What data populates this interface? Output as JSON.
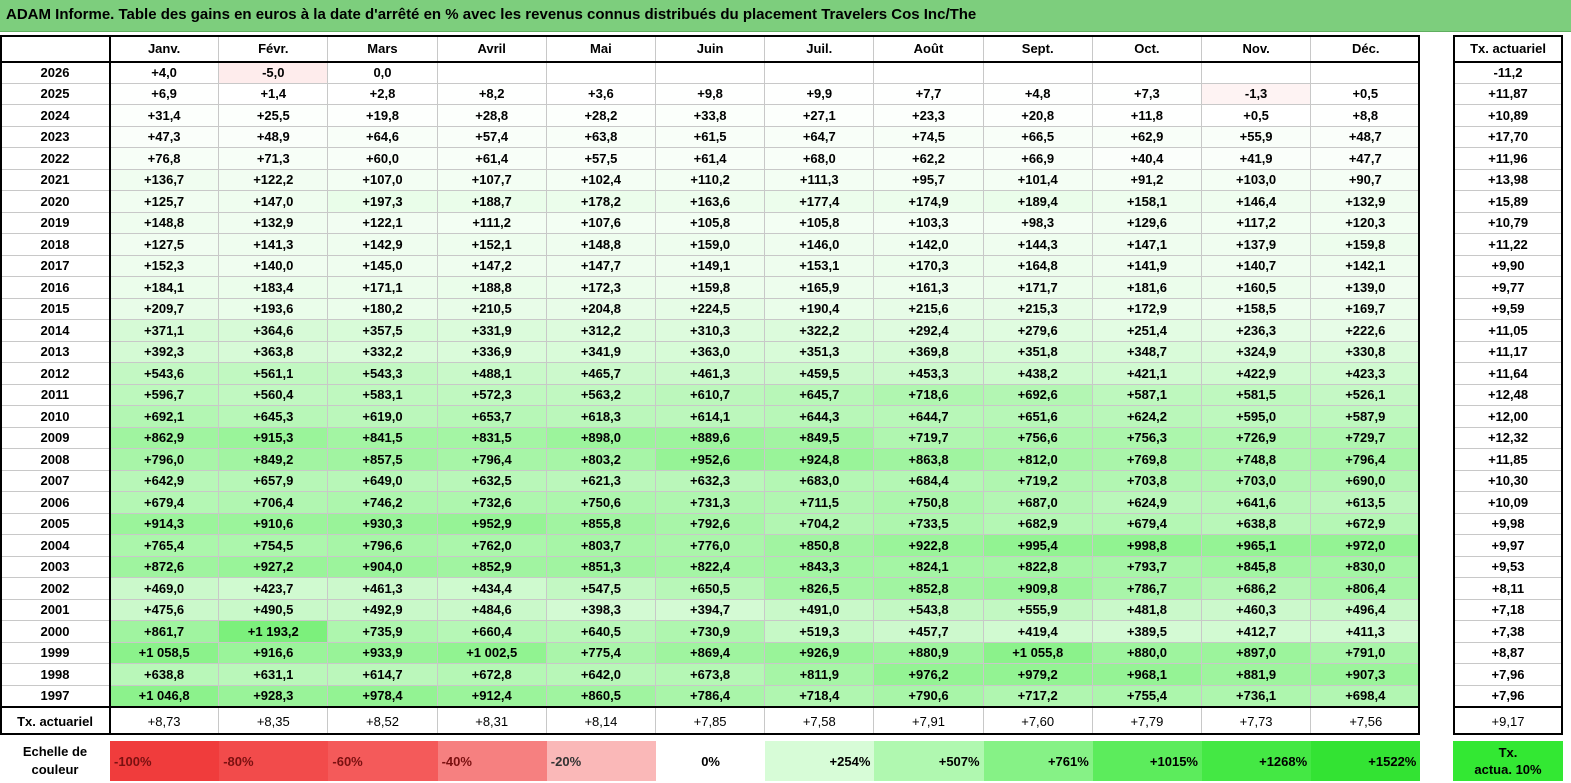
{
  "title": "ADAM Informe. Table des gains en euros à la date d'arrêté en % avec les revenus connus distribués du placement Travelers Cos Inc/The",
  "chart_data": {
    "type": "table",
    "columns": [
      "Janv.",
      "Févr.",
      "Mars",
      "Avril",
      "Mai",
      "Juin",
      "Juil.",
      "Août",
      "Sept.",
      "Oct.",
      "Nov.",
      "Déc."
    ],
    "annual_header": "Tx. actuariel",
    "rows": [
      {
        "year": "2026",
        "values": [
          "+4,0",
          "-5,0",
          "0,0",
          "",
          "",
          "",
          "",
          "",
          "",
          "",
          "",
          ""
        ],
        "annual": "-11,2"
      },
      {
        "year": "2025",
        "values": [
          "+6,9",
          "+1,4",
          "+2,8",
          "+8,2",
          "+3,6",
          "+9,8",
          "+9,9",
          "+7,7",
          "+4,8",
          "+7,3",
          "-1,3",
          "+0,5"
        ],
        "annual": "+11,87"
      },
      {
        "year": "2024",
        "values": [
          "+31,4",
          "+25,5",
          "+19,8",
          "+28,8",
          "+28,2",
          "+33,8",
          "+27,1",
          "+23,3",
          "+20,8",
          "+11,8",
          "+0,5",
          "+8,8"
        ],
        "annual": "+10,89"
      },
      {
        "year": "2023",
        "values": [
          "+47,3",
          "+48,9",
          "+64,6",
          "+57,4",
          "+63,8",
          "+61,5",
          "+64,7",
          "+74,5",
          "+66,5",
          "+62,9",
          "+55,9",
          "+48,7"
        ],
        "annual": "+17,70"
      },
      {
        "year": "2022",
        "values": [
          "+76,8",
          "+71,3",
          "+60,0",
          "+61,4",
          "+57,5",
          "+61,4",
          "+68,0",
          "+62,2",
          "+66,9",
          "+40,4",
          "+41,9",
          "+47,7"
        ],
        "annual": "+11,96"
      },
      {
        "year": "2021",
        "values": [
          "+136,7",
          "+122,2",
          "+107,0",
          "+107,7",
          "+102,4",
          "+110,2",
          "+111,3",
          "+95,7",
          "+101,4",
          "+91,2",
          "+103,0",
          "+90,7"
        ],
        "annual": "+13,98"
      },
      {
        "year": "2020",
        "values": [
          "+125,7",
          "+147,0",
          "+197,3",
          "+188,7",
          "+178,2",
          "+163,6",
          "+177,4",
          "+174,9",
          "+189,4",
          "+158,1",
          "+146,4",
          "+132,9"
        ],
        "annual": "+15,89"
      },
      {
        "year": "2019",
        "values": [
          "+148,8",
          "+132,9",
          "+122,1",
          "+111,2",
          "+107,6",
          "+105,8",
          "+105,8",
          "+103,3",
          "+98,3",
          "+129,6",
          "+117,2",
          "+120,3"
        ],
        "annual": "+10,79"
      },
      {
        "year": "2018",
        "values": [
          "+127,5",
          "+141,3",
          "+142,9",
          "+152,1",
          "+148,8",
          "+159,0",
          "+146,0",
          "+142,0",
          "+144,3",
          "+147,1",
          "+137,9",
          "+159,8"
        ],
        "annual": "+11,22"
      },
      {
        "year": "2017",
        "values": [
          "+152,3",
          "+140,0",
          "+145,0",
          "+147,2",
          "+147,7",
          "+149,1",
          "+153,1",
          "+170,3",
          "+164,8",
          "+141,9",
          "+140,7",
          "+142,1"
        ],
        "annual": "+9,90"
      },
      {
        "year": "2016",
        "values": [
          "+184,1",
          "+183,4",
          "+171,1",
          "+188,8",
          "+172,3",
          "+159,8",
          "+165,9",
          "+161,3",
          "+171,7",
          "+181,6",
          "+160,5",
          "+139,0"
        ],
        "annual": "+9,77"
      },
      {
        "year": "2015",
        "values": [
          "+209,7",
          "+193,6",
          "+180,2",
          "+210,5",
          "+204,8",
          "+224,5",
          "+190,4",
          "+215,6",
          "+215,3",
          "+172,9",
          "+158,5",
          "+169,7"
        ],
        "annual": "+9,59"
      },
      {
        "year": "2014",
        "values": [
          "+371,1",
          "+364,6",
          "+357,5",
          "+331,9",
          "+312,2",
          "+310,3",
          "+322,2",
          "+292,4",
          "+279,6",
          "+251,4",
          "+236,3",
          "+222,6"
        ],
        "annual": "+11,05"
      },
      {
        "year": "2013",
        "values": [
          "+392,3",
          "+363,8",
          "+332,2",
          "+336,9",
          "+341,9",
          "+363,0",
          "+351,3",
          "+369,8",
          "+351,8",
          "+348,7",
          "+324,9",
          "+330,8"
        ],
        "annual": "+11,17"
      },
      {
        "year": "2012",
        "values": [
          "+543,6",
          "+561,1",
          "+543,3",
          "+488,1",
          "+465,7",
          "+461,3",
          "+459,5",
          "+453,3",
          "+438,2",
          "+421,1",
          "+422,9",
          "+423,3"
        ],
        "annual": "+11,64"
      },
      {
        "year": "2011",
        "values": [
          "+596,7",
          "+560,4",
          "+583,1",
          "+572,3",
          "+563,2",
          "+610,7",
          "+645,7",
          "+718,6",
          "+692,6",
          "+587,1",
          "+581,5",
          "+526,1"
        ],
        "annual": "+12,48"
      },
      {
        "year": "2010",
        "values": [
          "+692,1",
          "+645,3",
          "+619,0",
          "+653,7",
          "+618,3",
          "+614,1",
          "+644,3",
          "+644,7",
          "+651,6",
          "+624,2",
          "+595,0",
          "+587,9"
        ],
        "annual": "+12,00"
      },
      {
        "year": "2009",
        "values": [
          "+862,9",
          "+915,3",
          "+841,5",
          "+831,5",
          "+898,0",
          "+889,6",
          "+849,5",
          "+719,7",
          "+756,6",
          "+756,3",
          "+726,9",
          "+729,7"
        ],
        "annual": "+12,32"
      },
      {
        "year": "2008",
        "values": [
          "+796,0",
          "+849,2",
          "+857,5",
          "+796,4",
          "+803,2",
          "+952,6",
          "+924,8",
          "+863,8",
          "+812,0",
          "+769,8",
          "+748,8",
          "+796,4"
        ],
        "annual": "+11,85"
      },
      {
        "year": "2007",
        "values": [
          "+642,9",
          "+657,9",
          "+649,0",
          "+632,5",
          "+621,3",
          "+632,3",
          "+683,0",
          "+684,4",
          "+719,2",
          "+703,8",
          "+703,0",
          "+690,0"
        ],
        "annual": "+10,30"
      },
      {
        "year": "2006",
        "values": [
          "+679,4",
          "+706,4",
          "+746,2",
          "+732,6",
          "+750,6",
          "+731,3",
          "+711,5",
          "+750,8",
          "+687,0",
          "+624,9",
          "+641,6",
          "+613,5"
        ],
        "annual": "+10,09"
      },
      {
        "year": "2005",
        "values": [
          "+914,3",
          "+910,6",
          "+930,3",
          "+952,9",
          "+855,8",
          "+792,6",
          "+704,2",
          "+733,5",
          "+682,9",
          "+679,4",
          "+638,8",
          "+672,9"
        ],
        "annual": "+9,98"
      },
      {
        "year": "2004",
        "values": [
          "+765,4",
          "+754,5",
          "+796,6",
          "+762,0",
          "+803,7",
          "+776,0",
          "+850,8",
          "+922,8",
          "+995,4",
          "+998,8",
          "+965,1",
          "+972,0"
        ],
        "annual": "+9,97"
      },
      {
        "year": "2003",
        "values": [
          "+872,6",
          "+927,2",
          "+904,0",
          "+852,9",
          "+851,3",
          "+822,4",
          "+843,3",
          "+824,1",
          "+822,8",
          "+793,7",
          "+845,8",
          "+830,0"
        ],
        "annual": "+9,53"
      },
      {
        "year": "2002",
        "values": [
          "+469,0",
          "+423,7",
          "+461,3",
          "+434,4",
          "+547,5",
          "+650,5",
          "+826,5",
          "+852,8",
          "+909,8",
          "+786,7",
          "+686,2",
          "+806,4"
        ],
        "annual": "+8,11"
      },
      {
        "year": "2001",
        "values": [
          "+475,6",
          "+490,5",
          "+492,9",
          "+484,6",
          "+398,3",
          "+394,7",
          "+491,0",
          "+543,8",
          "+555,9",
          "+481,8",
          "+460,3",
          "+496,4"
        ],
        "annual": "+7,18"
      },
      {
        "year": "2000",
        "values": [
          "+861,7",
          "+1 193,2",
          "+735,9",
          "+660,4",
          "+640,5",
          "+730,9",
          "+519,3",
          "+457,7",
          "+419,4",
          "+389,5",
          "+412,7",
          "+411,3"
        ],
        "annual": "+7,38"
      },
      {
        "year": "1999",
        "values": [
          "+1 058,5",
          "+916,6",
          "+933,9",
          "+1 002,5",
          "+775,4",
          "+869,4",
          "+926,9",
          "+880,9",
          "+1 055,8",
          "+880,0",
          "+897,0",
          "+791,0"
        ],
        "annual": "+8,87"
      },
      {
        "year": "1998",
        "values": [
          "+638,8",
          "+631,1",
          "+614,7",
          "+672,8",
          "+642,0",
          "+673,8",
          "+811,9",
          "+976,2",
          "+979,2",
          "+968,1",
          "+881,9",
          "+907,3"
        ],
        "annual": "+7,96"
      },
      {
        "year": "1997",
        "values": [
          "+1 046,8",
          "+928,3",
          "+978,4",
          "+912,4",
          "+860,5",
          "+786,4",
          "+718,4",
          "+790,6",
          "+717,2",
          "+755,4",
          "+736,1",
          "+698,4"
        ],
        "annual": "+7,96"
      }
    ],
    "footer": {
      "label": "Tx. actuariel",
      "values": [
        "+8,73",
        "+8,35",
        "+8,52",
        "+8,31",
        "+8,14",
        "+7,85",
        "+7,58",
        "+7,91",
        "+7,60",
        "+7,79",
        "+7,73",
        "+7,56"
      ],
      "annual": "+9,17"
    }
  },
  "legend": {
    "label_line1": "Echelle de",
    "label_line2": "couleur",
    "items": [
      {
        "text": "-100%",
        "color": "#f03c3c"
      },
      {
        "text": "-80%",
        "color": "#f24b4b"
      },
      {
        "text": "-60%",
        "color": "#f45a5a"
      },
      {
        "text": "-40%",
        "color": "#f68080"
      },
      {
        "text": "-20%",
        "color": "#fab8b8"
      },
      {
        "text": "0%",
        "color": "#ffffff"
      },
      {
        "text": "+254%",
        "color": "#d7fcd7"
      },
      {
        "text": "+507%",
        "color": "#b0f8b0"
      },
      {
        "text": "+761%",
        "color": "#86f286"
      },
      {
        "text": "+1015%",
        "color": "#5cec5c"
      },
      {
        "text": "+1268%",
        "color": "#44e844"
      },
      {
        "text": "+1522%",
        "color": "#33e333"
      }
    ],
    "tx_line1": "Tx.",
    "tx_line2": "actua. 10%"
  },
  "colors": {
    "title_bg": "#7dce7d",
    "green_max": "#33e833",
    "red_max": "#f03c3c",
    "neutral": "#ffffff"
  }
}
